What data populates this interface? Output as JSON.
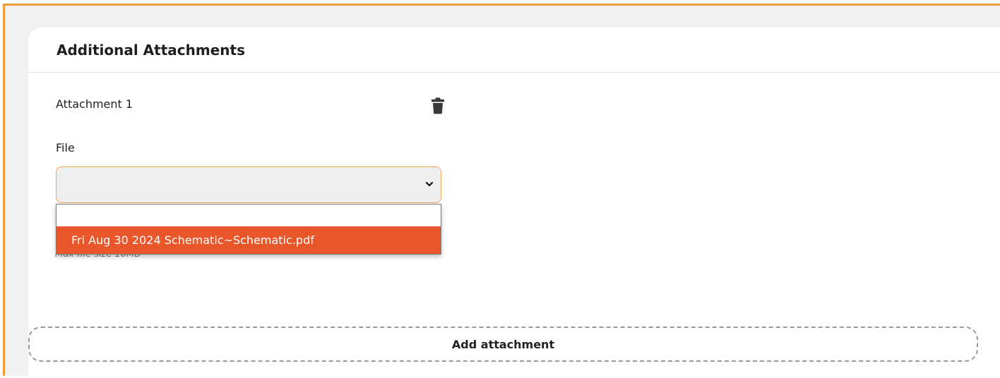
{
  "card": {
    "title": "Additional Attachments"
  },
  "attachment": {
    "label": "Attachment 1",
    "delete_icon": "trash-icon"
  },
  "file_field": {
    "label": "File",
    "value": "",
    "options": [
      "",
      "Fri Aug 30 2024 Schematic~Schematic.pdf"
    ],
    "highlighted_option": "Fri Aug 30 2024 Schematic~Schematic.pdf",
    "hint": "Max file size 10MB"
  },
  "actions": {
    "add_attachment_label": "Add attachment"
  },
  "colors": {
    "accent_border": "#ef9a3c",
    "highlight": "#e8562a"
  }
}
